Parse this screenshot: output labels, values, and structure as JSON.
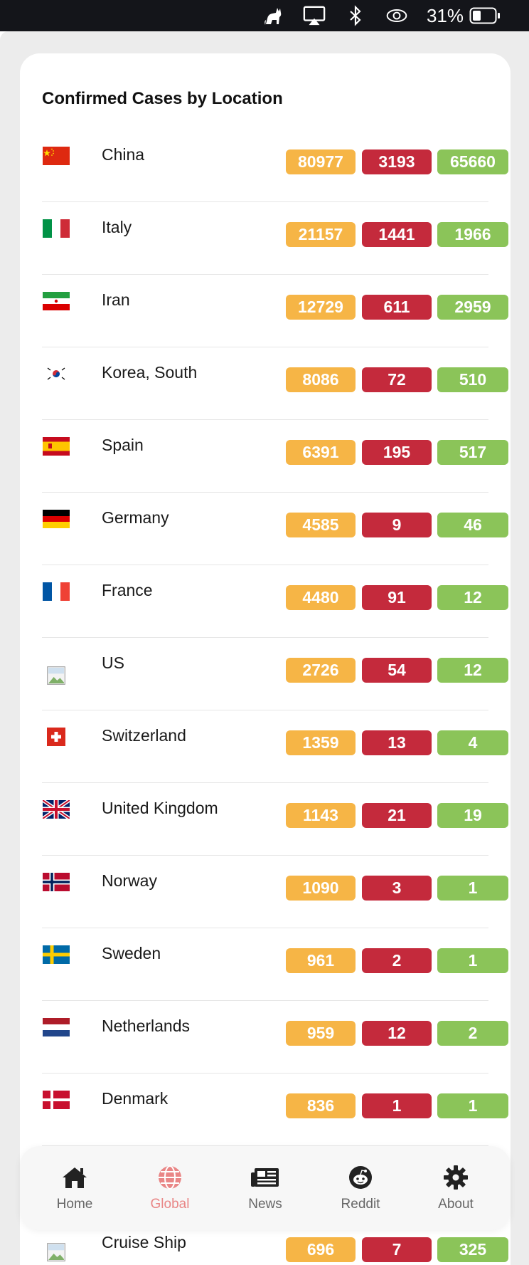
{
  "statusbar": {
    "battery_percent": "31%"
  },
  "card": {
    "title": "Confirmed Cases by Location"
  },
  "locations": [
    {
      "name": "China",
      "confirmed": "80977",
      "deaths": "3193",
      "recovered": "65660",
      "flag": "china-flag-icon"
    },
    {
      "name": "Italy",
      "confirmed": "21157",
      "deaths": "1441",
      "recovered": "1966",
      "flag": "italy-flag-icon"
    },
    {
      "name": "Iran",
      "confirmed": "12729",
      "deaths": "611",
      "recovered": "2959",
      "flag": "iran-flag-icon"
    },
    {
      "name": "Korea, South",
      "confirmed": "8086",
      "deaths": "72",
      "recovered": "510",
      "flag": "south-korea-flag-icon"
    },
    {
      "name": "Spain",
      "confirmed": "6391",
      "deaths": "195",
      "recovered": "517",
      "flag": "spain-flag-icon"
    },
    {
      "name": "Germany",
      "confirmed": "4585",
      "deaths": "9",
      "recovered": "46",
      "flag": "germany-flag-icon"
    },
    {
      "name": "France",
      "confirmed": "4480",
      "deaths": "91",
      "recovered": "12",
      "flag": "france-flag-icon"
    },
    {
      "name": "US",
      "confirmed": "2726",
      "deaths": "54",
      "recovered": "12",
      "flag": "broken-image-icon"
    },
    {
      "name": "Switzerland",
      "confirmed": "1359",
      "deaths": "13",
      "recovered": "4",
      "flag": "switzerland-flag-icon"
    },
    {
      "name": "United Kingdom",
      "confirmed": "1143",
      "deaths": "21",
      "recovered": "19",
      "flag": "uk-flag-icon"
    },
    {
      "name": "Norway",
      "confirmed": "1090",
      "deaths": "3",
      "recovered": "1",
      "flag": "norway-flag-icon"
    },
    {
      "name": "Sweden",
      "confirmed": "961",
      "deaths": "2",
      "recovered": "1",
      "flag": "sweden-flag-icon"
    },
    {
      "name": "Netherlands",
      "confirmed": "959",
      "deaths": "12",
      "recovered": "2",
      "flag": "netherlands-flag-icon"
    },
    {
      "name": "Denmark",
      "confirmed": "836",
      "deaths": "1",
      "recovered": "1",
      "flag": "denmark-flag-icon"
    }
  ],
  "partial_row": {
    "name": "Cruise Ship",
    "confirmed": "696",
    "deaths": "7",
    "recovered": "325",
    "flag": "broken-image-icon"
  },
  "colors": {
    "confirmed": "#f6b546",
    "deaths": "#c42a3c",
    "recovered": "#8bc459",
    "active_tab": "#e98686"
  },
  "tabs": [
    {
      "label": "Home",
      "icon": "home-icon",
      "active": false
    },
    {
      "label": "Global",
      "icon": "globe-icon",
      "active": true
    },
    {
      "label": "News",
      "icon": "newspaper-icon",
      "active": false
    },
    {
      "label": "Reddit",
      "icon": "reddit-icon",
      "active": false
    },
    {
      "label": "About",
      "icon": "gear-icon",
      "active": false
    }
  ]
}
